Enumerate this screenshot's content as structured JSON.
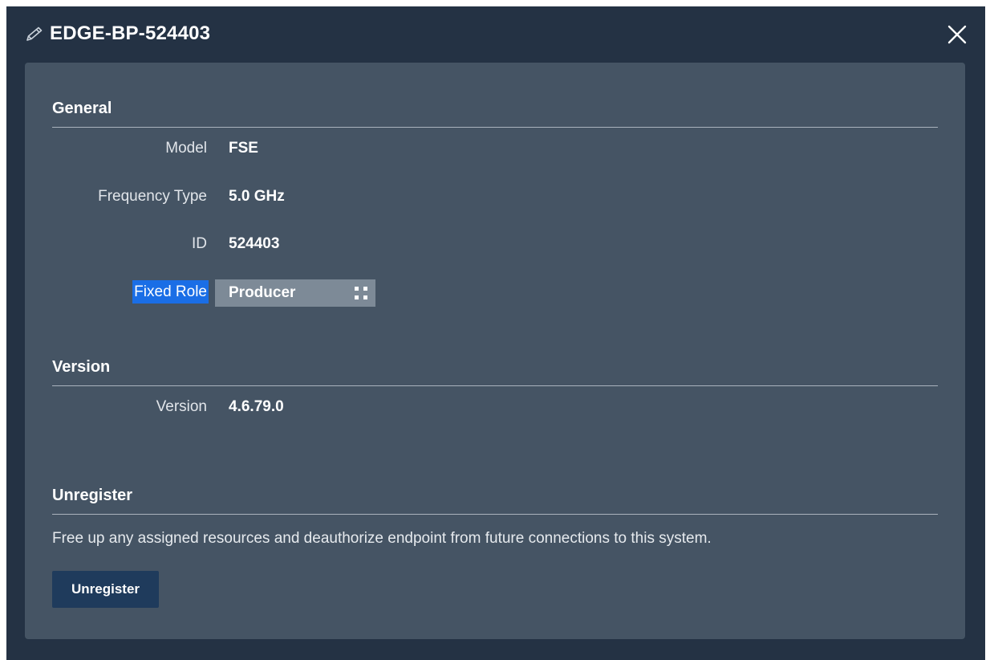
{
  "dialog": {
    "title": "EDGE-BP-524403",
    "icons": {
      "title_icon": "pencil-icon",
      "close_icon": "close-icon"
    }
  },
  "general": {
    "section_title": "General",
    "fields": [
      {
        "label": "Model",
        "value": "FSE"
      },
      {
        "label": "Frequency Type",
        "value": "5.0 GHz"
      },
      {
        "label": "ID",
        "value": "524403"
      }
    ],
    "fixed_role": {
      "label": "Fixed Role",
      "selected_value": "Producer",
      "icon": "grip-icon"
    }
  },
  "version": {
    "section_title": "Version",
    "label": "Version",
    "value": "4.6.79.0"
  },
  "unregister": {
    "section_title": "Unregister",
    "description": "Free up any assigned resources and deauthorize endpoint from future connections to this system.",
    "button_label": "Unregister"
  },
  "colors": {
    "dialog_background": "#243244",
    "panel_background": "#455464",
    "selection_highlight": "#1a6ee6",
    "select_background": "#7d8a97",
    "button_background": "#1f3b5c"
  }
}
